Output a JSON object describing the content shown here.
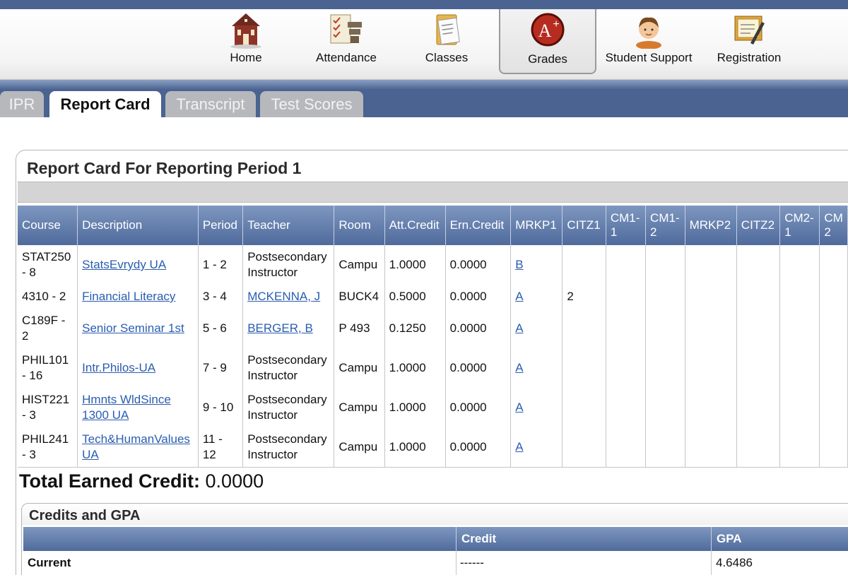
{
  "nav": {
    "items": [
      {
        "label": "Home",
        "icon": "schoolhouse-icon"
      },
      {
        "label": "Attendance",
        "icon": "attendance-desks-icon"
      },
      {
        "label": "Classes",
        "icon": "notebook-icon"
      },
      {
        "label": "Grades",
        "icon": "grade-a-plus-icon",
        "active": true
      },
      {
        "label": "Student Support",
        "icon": "student-avatar-icon"
      },
      {
        "label": "Registration",
        "icon": "registration-form-icon"
      }
    ]
  },
  "tabs": [
    {
      "label": "IPR",
      "active": false
    },
    {
      "label": "Report Card",
      "active": true
    },
    {
      "label": "Transcript",
      "active": false
    },
    {
      "label": "Test Scores",
      "active": false
    }
  ],
  "report": {
    "title": "Report Card For Reporting Period 1",
    "columns": [
      "Course",
      "Description",
      "Period",
      "Teacher",
      "Room",
      "Att.Credit",
      "Ern.Credit",
      "MRKP1",
      "CITZ1",
      "CM1-\n1",
      "CM1-\n2",
      "MRKP2",
      "CITZ2",
      "CM2-\n1",
      "CM\n2"
    ],
    "rows": [
      {
        "course": "STAT250\n- 8",
        "description": "StatsEvrydy UA",
        "period": "1 - 2",
        "teacher": "Postsecondary\nInstructor",
        "teacher_link": false,
        "room": "Campu",
        "att": "1.0000",
        "ern": "0.0000",
        "mrkp1": "B",
        "citz1": ""
      },
      {
        "course": "4310 - 2",
        "description": "Financial Literacy",
        "period": "3 - 4",
        "teacher": "MCKENNA, J",
        "teacher_link": true,
        "room": "BUCK4",
        "att": "0.5000",
        "ern": "0.0000",
        "mrkp1": "A",
        "citz1": "2"
      },
      {
        "course": "C189F -\n2",
        "description": "Senior Seminar 1st",
        "period": "5 - 6",
        "teacher": "BERGER, B",
        "teacher_link": true,
        "room": "P 493",
        "att": "0.1250",
        "ern": "0.0000",
        "mrkp1": "A",
        "citz1": ""
      },
      {
        "course": "PHIL101\n- 16",
        "description": "Intr.Philos-UA",
        "period": "7 - 9",
        "teacher": "Postsecondary\nInstructor",
        "teacher_link": false,
        "room": "Campu",
        "att": "1.0000",
        "ern": "0.0000",
        "mrkp1": "A",
        "citz1": ""
      },
      {
        "course": "HIST221\n- 3",
        "description": "Hmnts WldSince\n1300 UA",
        "period": "9 - 10",
        "teacher": "Postsecondary\nInstructor",
        "teacher_link": false,
        "room": "Campu",
        "att": "1.0000",
        "ern": "0.0000",
        "mrkp1": "A",
        "citz1": ""
      },
      {
        "course": "PHIL241\n- 3",
        "description": "Tech&HumanValues\nUA",
        "period": "11 -\n12",
        "teacher": "Postsecondary\nInstructor",
        "teacher_link": false,
        "room": "Campu",
        "att": "1.0000",
        "ern": "0.0000",
        "mrkp1": "A",
        "citz1": ""
      }
    ],
    "total_label": "Total Earned Credit:",
    "total_value": " 0.0000"
  },
  "gpa": {
    "title": "Credits and GPA",
    "headers": {
      "blank": "",
      "credit": "Credit",
      "gpa": "GPA"
    },
    "row": {
      "label": "Current",
      "credit": "------",
      "gpa": "4.6486"
    }
  },
  "colors": {
    "brand_blue": "#4a6391",
    "header_blue": "#5f7aa9",
    "link": "#2a5db0"
  }
}
